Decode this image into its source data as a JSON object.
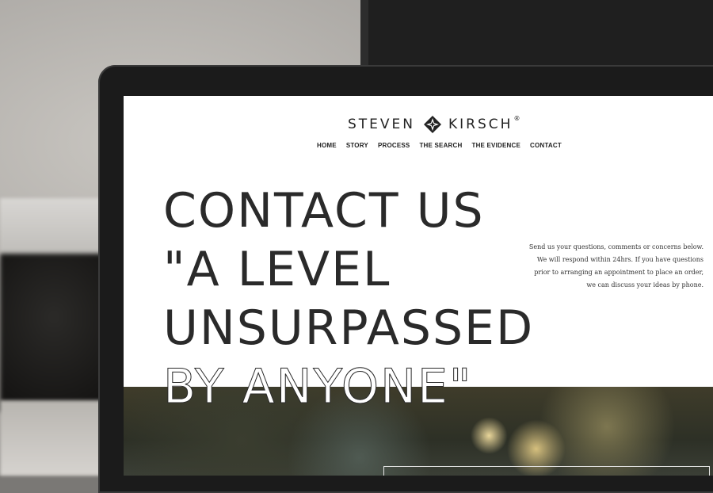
{
  "brand": {
    "name_left": "STEVEN",
    "name_right": "KIRSCH",
    "registered": "®",
    "logo_icon": "diamond-star-logo-icon"
  },
  "nav": {
    "items": [
      "HOME",
      "STORY",
      "PROCESS",
      "THE SEARCH",
      "THE EVIDENCE",
      "CONTACT"
    ]
  },
  "hero": {
    "lines": [
      "CONTACT US",
      "\"A LEVEL",
      "UNSURPASSED",
      "BY ANYONE\""
    ]
  },
  "info": {
    "lines": [
      "Send us your questions, comments or concerns below.",
      "We will respond within 24hrs. If you have questions",
      "prior to arranging an appointment to place an order,",
      "we can discuss your ideas by phone."
    ]
  },
  "colors": {
    "text": "#2a2a2a",
    "page_bg": "#ffffff",
    "bezel": "#1b1b1b"
  }
}
